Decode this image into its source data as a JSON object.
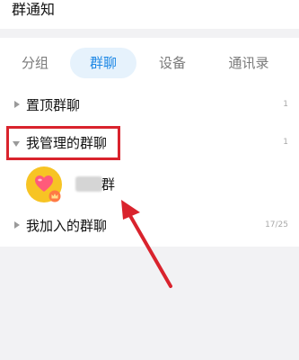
{
  "header": {
    "title": "群通知"
  },
  "tabs": [
    {
      "label": "分组"
    },
    {
      "label": "群聊"
    },
    {
      "label": "设备"
    },
    {
      "label": "通讯录"
    }
  ],
  "active_tab": "群聊",
  "groups": {
    "pinned": {
      "label": "置顶群聊",
      "count": ""
    },
    "managed": {
      "label": "我管理的群聊",
      "count": "1"
    },
    "joined": {
      "label": "我加入的群聊",
      "count": "17/25"
    }
  },
  "pinned_count": "1",
  "managed_item": {
    "name_suffix": "群"
  },
  "colors": {
    "accent": "#1e88e5",
    "tab_active_bg": "#e6f2fc",
    "annotation_red": "#d9232d",
    "avatar_bg": "#f7c424",
    "heart": "#ff5a7a"
  }
}
